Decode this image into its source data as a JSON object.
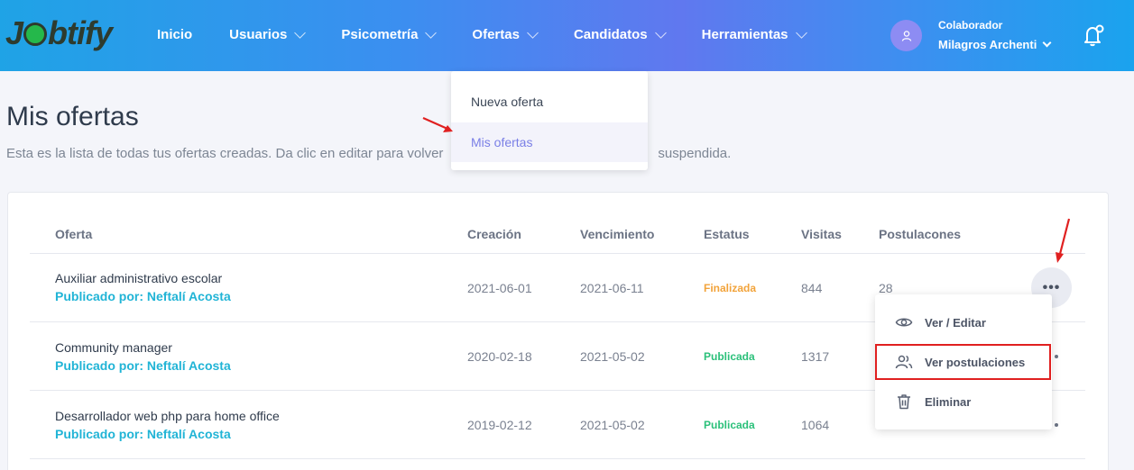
{
  "brand": {
    "logo_text": "Jobtify"
  },
  "nav": {
    "items": [
      {
        "label": "Inicio",
        "has_dropdown": false
      },
      {
        "label": "Usuarios",
        "has_dropdown": true
      },
      {
        "label": "Psicometría",
        "has_dropdown": true
      },
      {
        "label": "Ofertas",
        "has_dropdown": true
      },
      {
        "label": "Candidatos",
        "has_dropdown": true
      },
      {
        "label": "Herramientas",
        "has_dropdown": true
      }
    ]
  },
  "user": {
    "role": "Colaborador",
    "name": "Milagros Archenti",
    "avatar_icon": "user-icon"
  },
  "notifications": {
    "icon": "bell-icon"
  },
  "ofertas_dropdown": {
    "items": [
      {
        "label": "Nueva oferta",
        "active": false
      },
      {
        "label": "Mis ofertas",
        "active": true
      }
    ]
  },
  "page": {
    "title": "Mis ofertas",
    "description_start": "Esta es la lista de todas tus ofertas creadas. Da clic en editar para volver",
    "description_end": "suspendida."
  },
  "table": {
    "headers": {
      "oferta": "Oferta",
      "creacion": "Creación",
      "vencimiento": "Vencimiento",
      "estatus": "Estatus",
      "visitas": "Visitas",
      "postulaciones": "Postulacones"
    },
    "rows": [
      {
        "title": "Auxiliar administrativo escolar",
        "published_by": "Publicado por: Neftalí Acosta",
        "creacion": "2021-06-01",
        "vencimiento": "2021-06-11",
        "estatus": "Finalizada",
        "estatus_color": "#f2a33a",
        "visitas": "844",
        "postulaciones": "28"
      },
      {
        "title": "Community manager",
        "published_by": "Publicado por: Neftalí Acosta",
        "creacion": "2020-02-18",
        "vencimiento": "2021-05-02",
        "estatus": "Publicada",
        "estatus_color": "#2bc07a",
        "visitas": "1317",
        "postulaciones": ""
      },
      {
        "title": "Desarrollador web php para home office",
        "published_by": "Publicado por: Neftalí Acosta",
        "creacion": "2019-02-12",
        "vencimiento": "2021-05-02",
        "estatus": "Publicada",
        "estatus_color": "#2bc07a",
        "visitas": "1064",
        "postulaciones": ""
      }
    ]
  },
  "actions_menu": {
    "trigger_label": "•••",
    "items": [
      {
        "label": "Ver / Editar",
        "icon": "eye-icon"
      },
      {
        "label": "Ver postulaciones",
        "icon": "users-icon",
        "highlighted": true
      },
      {
        "label": "Eliminar",
        "icon": "trash-icon"
      }
    ]
  },
  "colors": {
    "header_gradient_start": "#1fa3e6",
    "header_gradient_mid": "#6078ef",
    "accent": "#7a7fe6",
    "link": "#21b4d6",
    "annotation_red": "#e02020"
  }
}
